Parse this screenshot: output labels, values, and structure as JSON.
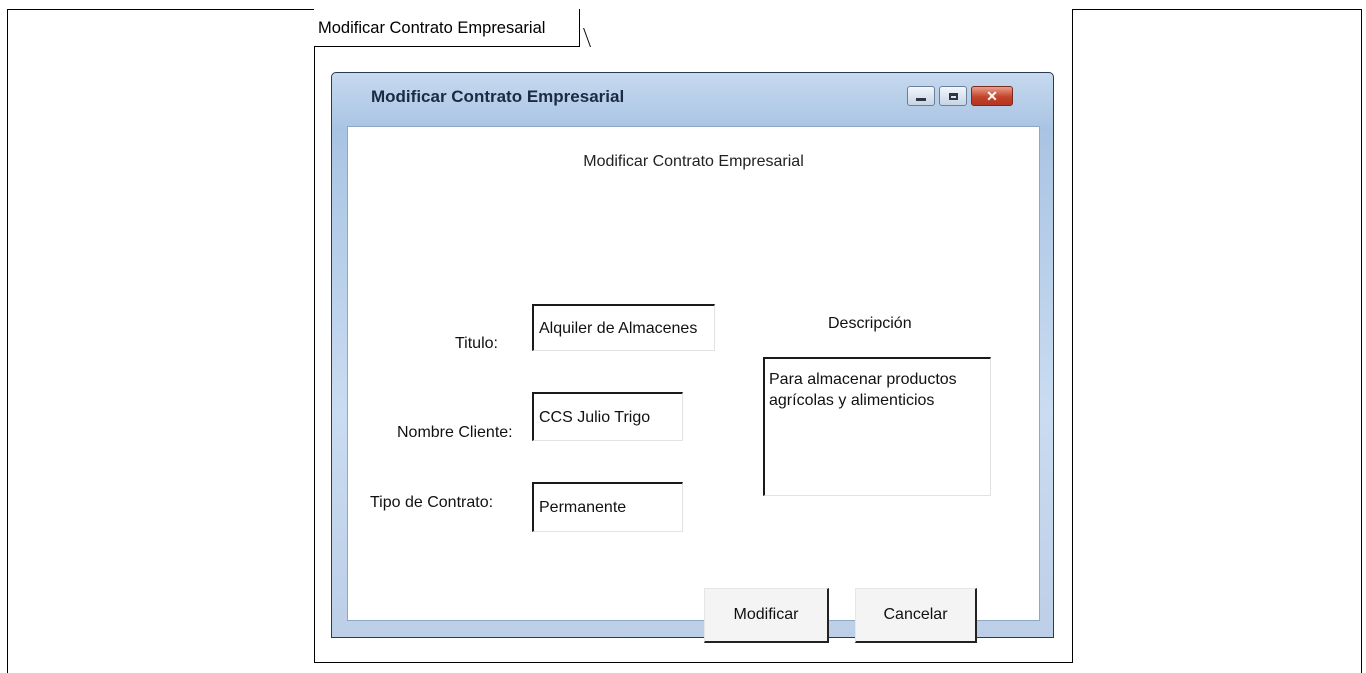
{
  "mockup": {
    "tab_label": "Modificar Contrato Empresarial"
  },
  "window": {
    "title": "Modificar Contrato Empresarial",
    "controls": {
      "minimize_icon": "minimize-icon",
      "maximize_icon": "maximize-icon",
      "close_icon": "close-icon",
      "close_glyph": "✕"
    }
  },
  "form": {
    "heading": "Modificar Contrato Empresarial",
    "titulo": {
      "label": "Titulo:",
      "value": "Alquiler de Almacenes"
    },
    "nombre_cliente": {
      "label": "Nombre Cliente:",
      "value": "CCS Julio Trigo"
    },
    "tipo_contrato": {
      "label": "Tipo de Contrato:",
      "value": "Permanente"
    },
    "descripcion": {
      "label": "Descripción",
      "value": "Para almacenar productos agrícolas y alimenticios"
    },
    "modificar_label": "Modificar",
    "cancelar_label": "Cancelar"
  }
}
